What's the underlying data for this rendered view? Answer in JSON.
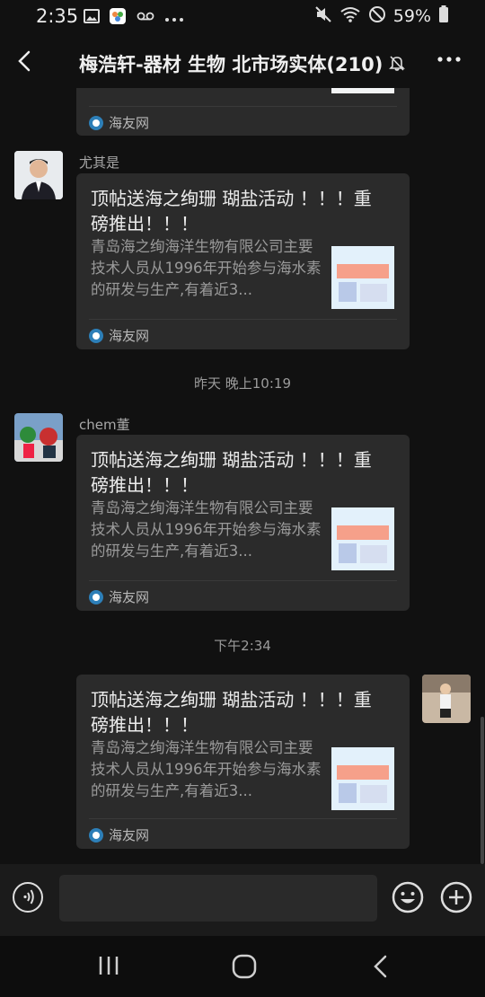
{
  "status": {
    "time": "2:35",
    "battery": "59%"
  },
  "header": {
    "title": "梅浩轩-器材 生物 北市场实体(210)"
  },
  "messages": [
    {
      "source": "海友网"
    },
    {
      "sender": "尤其是",
      "title": "顶帖送海之绚珊 瑚盐活动 ！！！重磅推出！！！",
      "desc": "青岛海之绚海洋生物有限公司主要技术人员从1996年开始参与海水素的研发与生产,有着近3...",
      "source": "海友网"
    },
    {
      "time": "昨天 晚上10:19",
      "sender": "chem董",
      "title": "顶帖送海之绚珊 瑚盐活动 ！！！重磅推出！！！",
      "desc": "青岛海之绚海洋生物有限公司主要技术人员从1996年开始参与海水素的研发与生产,有着近3...",
      "source": "海友网"
    },
    {
      "time": "下午2:34",
      "title": "顶帖送海之绚珊 瑚盐活动 ！！！重磅推出！！！",
      "desc": "青岛海之绚海洋生物有限公司主要技术人员从1996年开始参与海水素的研发与生产,有着近3...",
      "source": "海友网"
    }
  ],
  "colors": {
    "background": "#111111",
    "card": "#2b2b2b",
    "accent": "#2d7fb8"
  }
}
